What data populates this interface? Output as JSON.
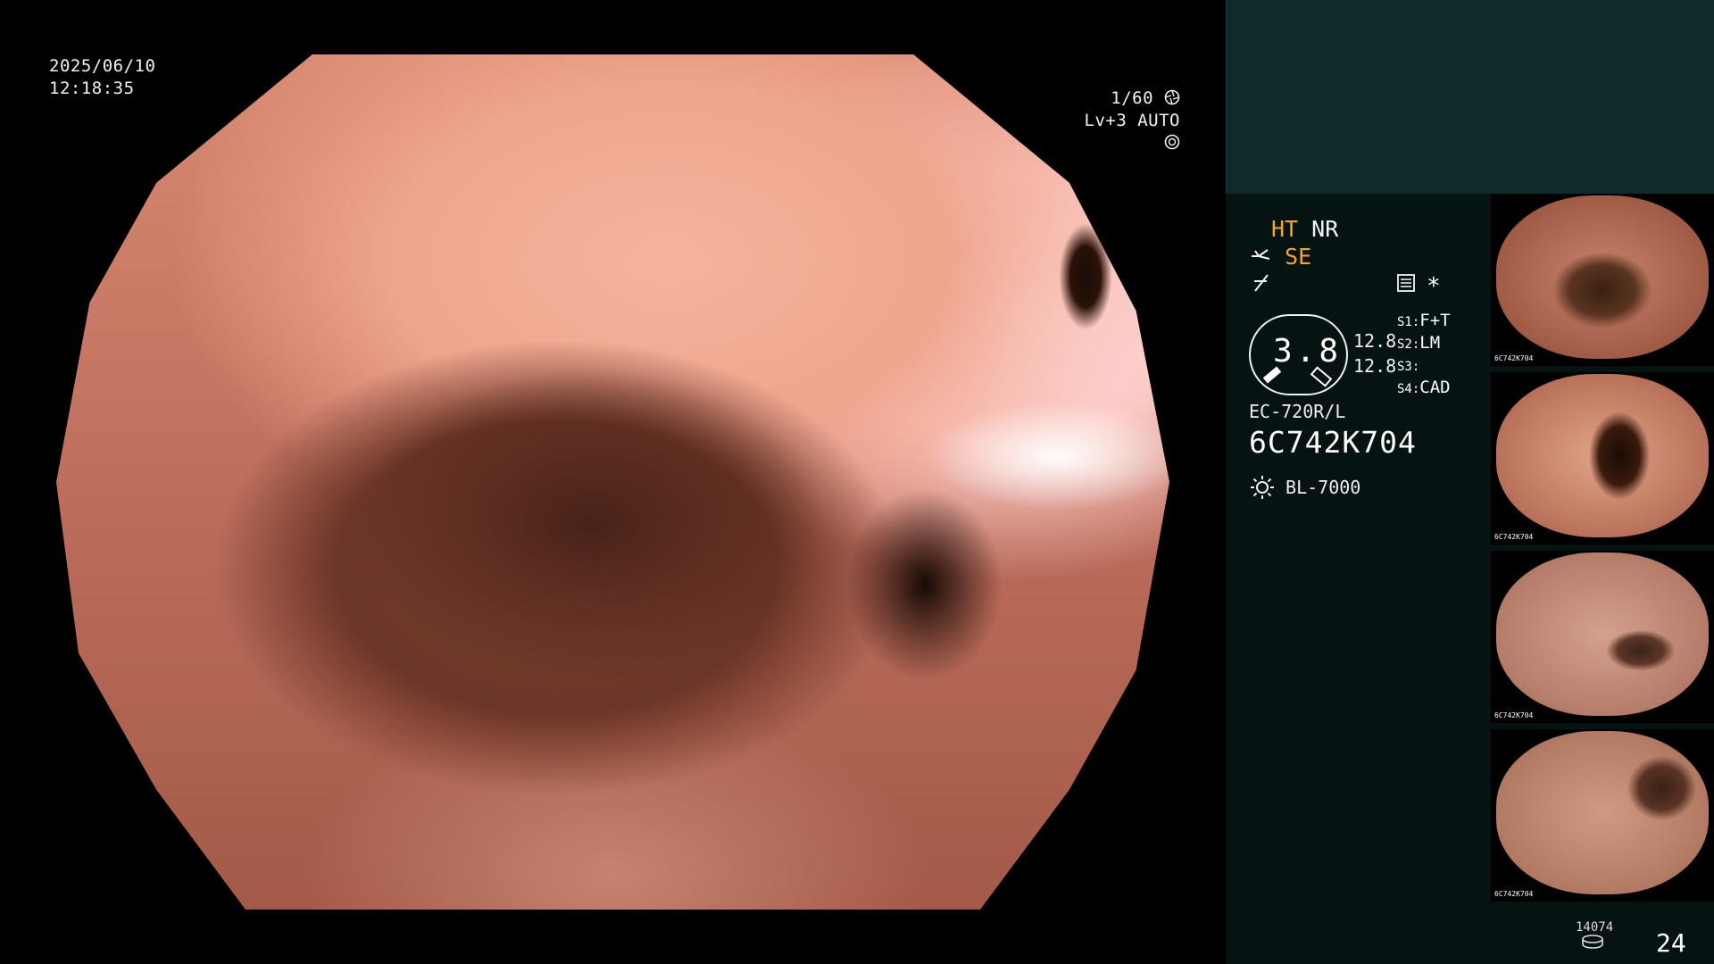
{
  "overlay": {
    "date": "2025/06/10",
    "time": "12:18:35",
    "shutter": "1/60",
    "shutter_icon": "aperture-icon",
    "level": "Lv+3",
    "exposure": "AUTO",
    "exposure_icon": "iris-icon"
  },
  "panel": {
    "mode_ht": "HT",
    "mode_nr": "NR",
    "mode_se": "SE",
    "structure_icon": "fork-icon",
    "freeze_icon": "slash-f-icon",
    "settings_icon": "menu-card-icon",
    "star": "*",
    "scope_value": "3.8",
    "range_top": "12.8",
    "range_bottom": "12.8",
    "switches": [
      {
        "key": "S1:",
        "value": "F+T"
      },
      {
        "key": "S2:",
        "value": "LM"
      },
      {
        "key": "S3:",
        "value": ""
      },
      {
        "key": "S4:",
        "value": "CAD"
      }
    ],
    "scope_model": "EC-720R/L",
    "scope_serial": "6C742K704",
    "light_icon": "sun-icon",
    "light_source": "BL-7000",
    "disk_count": "14074",
    "disk_icon": "disk-icon",
    "image_counter": "24"
  },
  "thumbnails": [
    {
      "id": "6C742K704"
    },
    {
      "id": "6C742K704"
    },
    {
      "id": "6C742K704"
    },
    {
      "id": "6C742K704"
    }
  ],
  "colors": {
    "accent_orange": "#f5a623",
    "panel_top": "#0e2a2b",
    "panel_bg": "#061313"
  }
}
